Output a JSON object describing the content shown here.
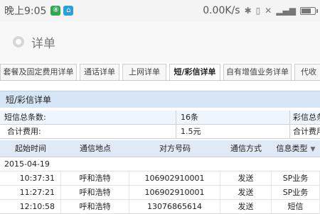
{
  "status_bar": {
    "time": "晚上9:05",
    "badge1": "⑧",
    "badge2": "⌂",
    "badge1_color": "#2fa84f",
    "badge2_color": "#28a0e0",
    "speed": "0.00K/s",
    "icons": [
      "bluetooth-icon",
      "vibrate-icon",
      "no-signal-icon",
      "signal-icon",
      "battery-icon"
    ],
    "battery_level": 0.75
  },
  "header": {
    "title": "详单"
  },
  "tabs": [
    {
      "label": "套餐及固定费用详单",
      "active": false
    },
    {
      "label": "通话详单",
      "active": false
    },
    {
      "label": "上网详单",
      "active": false
    },
    {
      "label": "短/彩信详单",
      "active": true
    },
    {
      "label": "自有增值业务详单",
      "active": false
    },
    {
      "label": "代收",
      "active": false
    }
  ],
  "section": {
    "title": "短/彩信详单"
  },
  "summary": {
    "sms_count_label": "短信总条数:",
    "sms_count_value": "16条",
    "mms_count_label": "彩信总条数",
    "fee_label": "合计费用:",
    "fee_value": "1.5元",
    "fee_label_right": "合计费用"
  },
  "table": {
    "headers": [
      "起始时间",
      "通信地点",
      "对方号码",
      "通信方式",
      "信息类型"
    ],
    "date": "2015-04-19",
    "rows": [
      [
        "10:37:31",
        "呼和浩特",
        "106902910001",
        "发送",
        "SP业务"
      ],
      [
        "11:27:21",
        "呼和浩特",
        "106902910001",
        "发送",
        "SP业务"
      ],
      [
        "12:10:58",
        "呼和浩特",
        "13076865614",
        "发送",
        "短信"
      ]
    ]
  },
  "colors": {
    "accent_blue": "#d7e6f6",
    "header_row": "#dfeaf6",
    "summary_row": "#eef5fd"
  }
}
